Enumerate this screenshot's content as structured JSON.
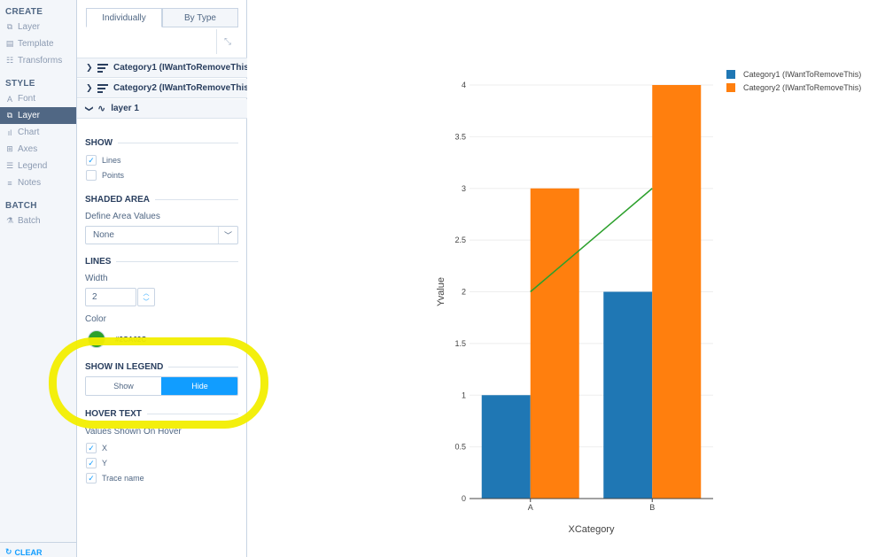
{
  "nav": {
    "create_title": "CREATE",
    "create_items": [
      {
        "label": "Layer",
        "icon": "layers-icon",
        "glyph": "⧉"
      },
      {
        "label": "Template",
        "icon": "template-icon",
        "glyph": "▤"
      },
      {
        "label": "Transforms",
        "icon": "transforms-icon",
        "glyph": "☷"
      }
    ],
    "style_title": "STYLE",
    "style_items": [
      {
        "label": "Font",
        "icon": "font-icon",
        "glyph": "A"
      },
      {
        "label": "Layer",
        "icon": "layers-icon",
        "glyph": "⧉",
        "active": true
      },
      {
        "label": "Chart",
        "icon": "chart-icon",
        "glyph": "ıl"
      },
      {
        "label": "Axes",
        "icon": "axes-icon",
        "glyph": "⊞"
      },
      {
        "label": "Legend",
        "icon": "legend-icon",
        "glyph": "☰"
      },
      {
        "label": "Notes",
        "icon": "notes-icon",
        "glyph": "≡"
      }
    ],
    "batch_title": "BATCH",
    "batch_items": [
      {
        "label": "Batch",
        "icon": "batch-icon",
        "glyph": "⚗"
      }
    ],
    "clear_label": "CLEAR"
  },
  "panel": {
    "tabs": [
      "Individually",
      "By Type"
    ],
    "traces": [
      {
        "label": "Category1 (IWantToRemoveThis)",
        "expanded": false
      },
      {
        "label": "Category2 (IWantToRemoveThis)",
        "expanded": false
      },
      {
        "label": "layer 1",
        "expanded": true
      }
    ],
    "show_title": "SHOW",
    "show_lines": "Lines",
    "show_points": "Points",
    "shaded_title": "SHADED AREA",
    "define_area_label": "Define Area Values",
    "define_area_value": "None",
    "lines_title": "LINES",
    "width_label": "Width",
    "width_value": "2",
    "color_label": "Color",
    "color_hex": "#2CA02C",
    "legend_title": "SHOW IN LEGEND",
    "legend_show": "Show",
    "legend_hide": "Hide",
    "legend_selected": "Hide",
    "hover_title": "HOVER TEXT",
    "hover_label": "Values Shown On Hover",
    "hover_x": "X",
    "hover_y": "Y",
    "hover_trace": "Trace name"
  },
  "colors": {
    "accent": "#119dff",
    "highlight": "#f2ee00",
    "series1": "#1f77b4",
    "series2": "#ff7f0e",
    "line": "#2ca02c"
  },
  "chart_data": {
    "type": "bar",
    "categories": [
      "A",
      "B"
    ],
    "series": [
      {
        "name": "Category1 (IWantToRemoveThis)",
        "values": [
          1,
          2
        ],
        "color": "#1f77b4"
      },
      {
        "name": "Category2 (IWantToRemoveThis)",
        "values": [
          3,
          4
        ],
        "color": "#ff7f0e"
      }
    ],
    "overlay_line": {
      "type": "line",
      "x": [
        "A",
        "B"
      ],
      "values": [
        2,
        3
      ],
      "color": "#2ca02c",
      "in_legend": false
    },
    "xlabel": "XCategory",
    "ylabel": "Yvalue",
    "ylim": [
      0,
      4
    ],
    "yticks": [
      "0",
      "0.5",
      "1",
      "1.5",
      "2",
      "2.5",
      "3",
      "3.5",
      "4"
    ],
    "grid": true,
    "legend": "top-right"
  }
}
